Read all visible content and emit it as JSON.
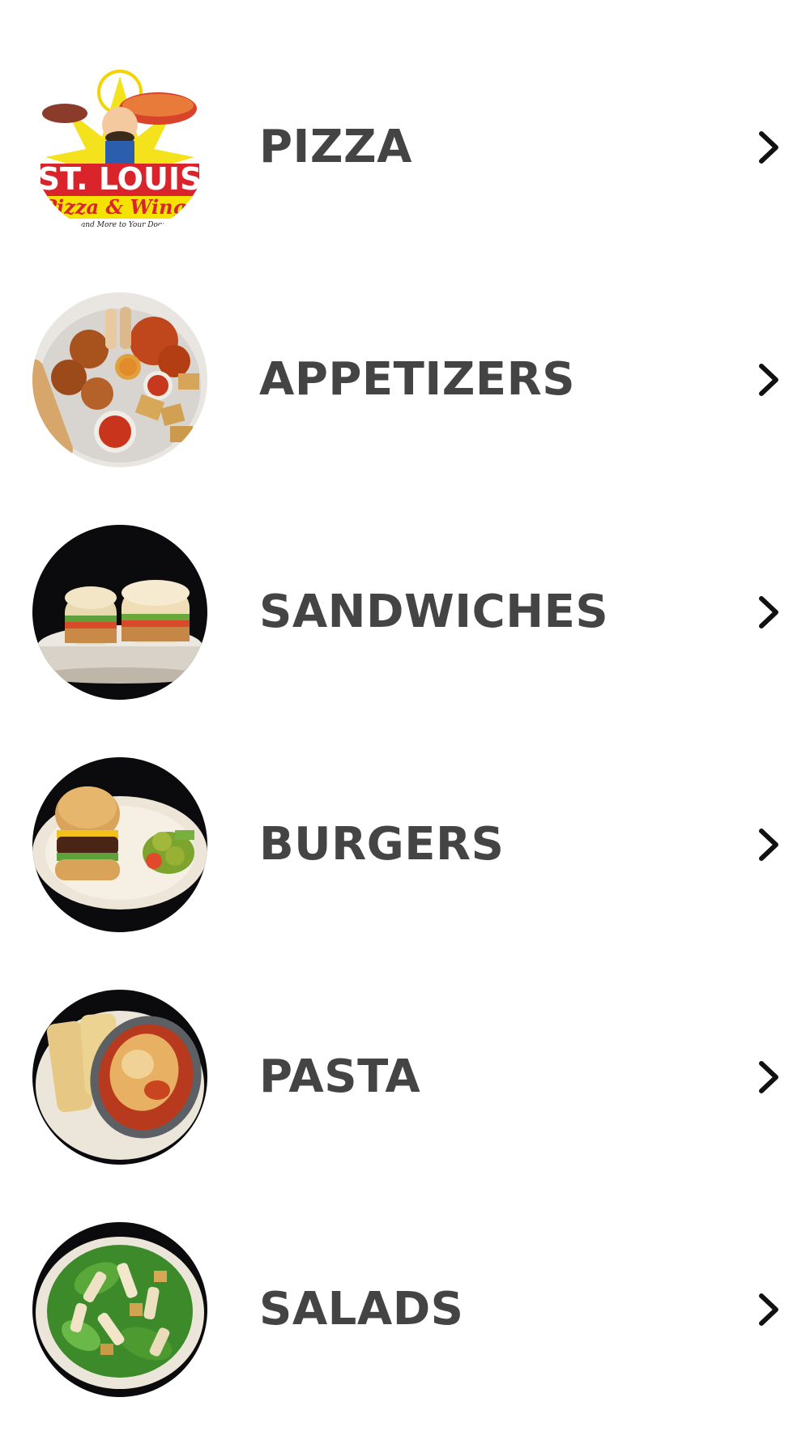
{
  "menu": {
    "items": [
      {
        "label": "PIZZA",
        "image": "st-louis-pizza-logo",
        "icon": "chevron-right-icon"
      },
      {
        "label": "APPETIZERS",
        "image": "appetizer-platter-photo",
        "icon": "chevron-right-icon"
      },
      {
        "label": "SANDWICHES",
        "image": "sandwiches-photo",
        "icon": "chevron-right-icon"
      },
      {
        "label": "BURGERS",
        "image": "burger-plate-photo",
        "icon": "chevron-right-icon"
      },
      {
        "label": "PASTA",
        "image": "pasta-dish-photo",
        "icon": "chevron-right-icon"
      },
      {
        "label": "SALADS",
        "image": "salad-plate-photo",
        "icon": "chevron-right-icon"
      }
    ]
  },
  "logo_text": {
    "line1": "ST. LOUIS",
    "line2": "Pizza & Wings",
    "tagline": "...and More to Your Door"
  },
  "colors": {
    "label": "#444444",
    "chevron": "#111111",
    "background": "#ffffff"
  }
}
